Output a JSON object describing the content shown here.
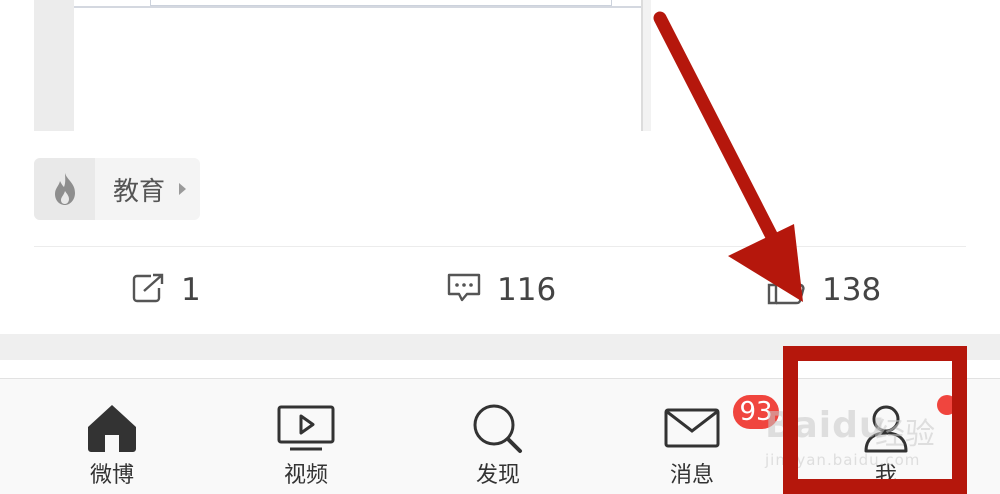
{
  "post": {
    "topic_tag": {
      "icon": "flame-icon",
      "label": "教育"
    },
    "actions": {
      "repost": {
        "icon": "share-icon",
        "count": "1"
      },
      "comment": {
        "icon": "comment-icon",
        "count": "116"
      },
      "like": {
        "icon": "thumbs-up-icon",
        "count": "138"
      }
    }
  },
  "tabbar": {
    "tabs": [
      {
        "id": "home",
        "label": "微博",
        "icon": "house-icon"
      },
      {
        "id": "video",
        "label": "视频",
        "icon": "tv-play-icon"
      },
      {
        "id": "discover",
        "label": "发现",
        "icon": "search-icon"
      },
      {
        "id": "messages",
        "label": "消息",
        "icon": "envelope-icon",
        "badge": "93"
      },
      {
        "id": "me",
        "label": "我",
        "icon": "person-icon",
        "dot": true
      }
    ]
  },
  "watermark": {
    "logo": "Baidu",
    "sub": "经验",
    "url": "jingyan.baidu.com"
  },
  "colors": {
    "badge": "#f0453e",
    "annotation": "#b5170c",
    "icon": "#333333"
  }
}
